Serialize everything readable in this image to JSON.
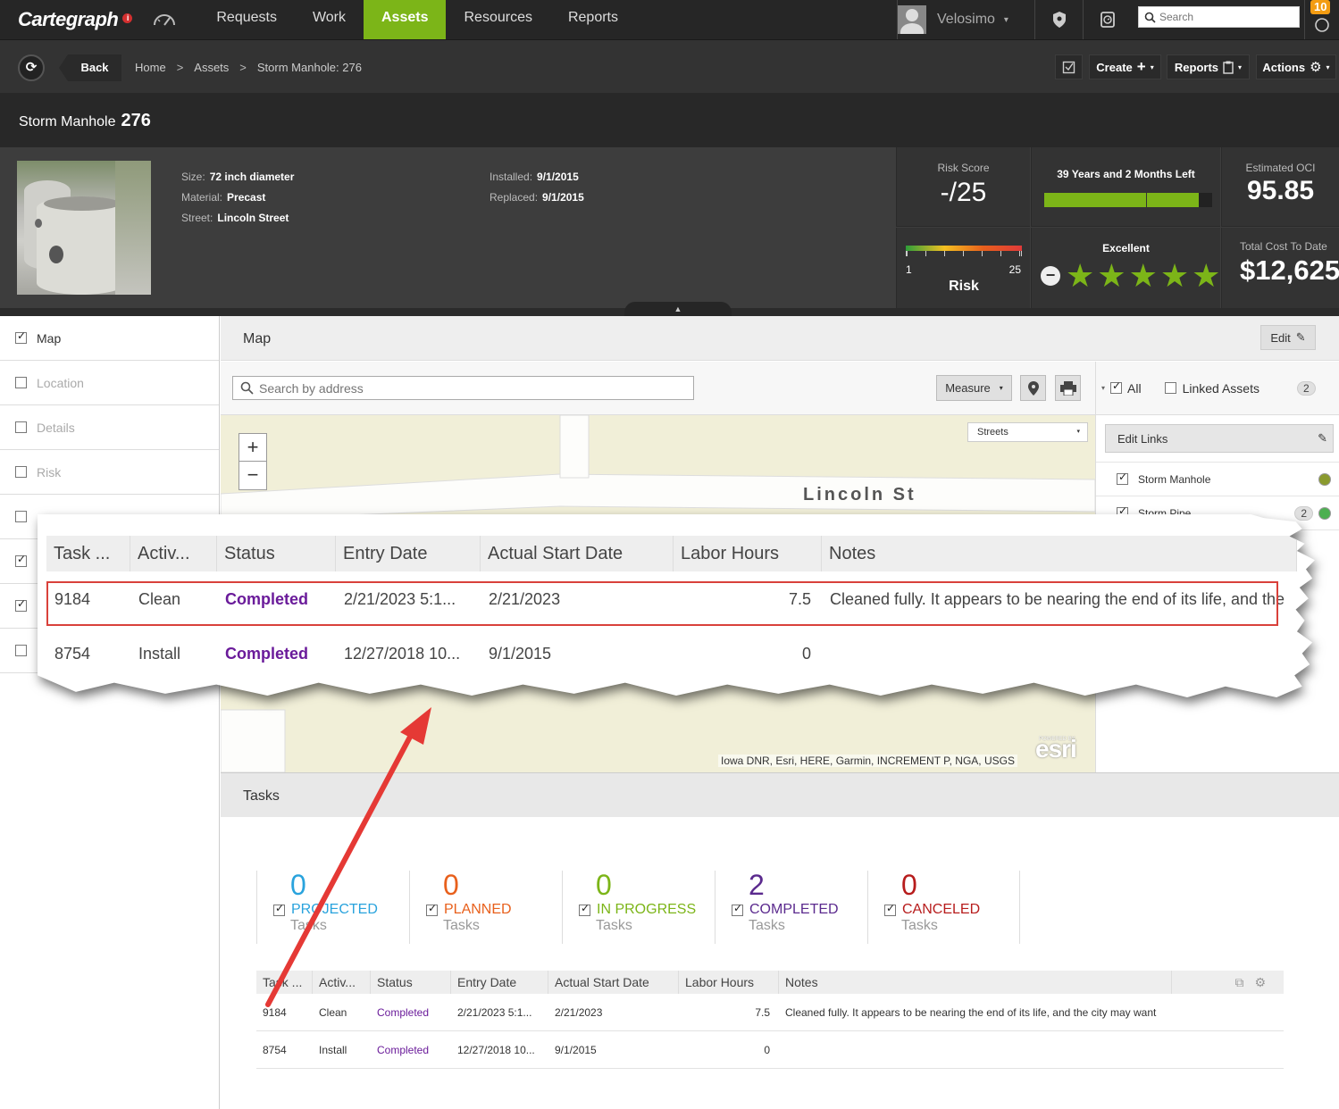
{
  "app": {
    "logo": "Cartegraph",
    "logo_badge": "i"
  },
  "nav": {
    "items": [
      "Requests",
      "Work",
      "Assets",
      "Resources",
      "Reports"
    ],
    "active": "Assets",
    "user": "Velosimo",
    "search_placeholder": "Search",
    "notification_count": "10"
  },
  "subhead": {
    "back": "Back",
    "breadcrumb": [
      "Home",
      "Assets",
      "Storm Manhole: 276"
    ],
    "create": "Create",
    "reports": "Reports",
    "actions": "Actions"
  },
  "record": {
    "type": "Storm Manhole",
    "id": "276"
  },
  "attributes": {
    "size_label": "Size:",
    "size": "72 inch diameter",
    "material_label": "Material:",
    "material": "Precast",
    "street_label": "Street:",
    "street": "Lincoln Street",
    "installed_label": "Installed:",
    "installed": "9/1/2015",
    "replaced_label": "Replaced:",
    "replaced": "9/1/2015"
  },
  "tiles": {
    "risk_score_label": "Risk Score",
    "risk_score": "-/25",
    "risk_min": "1",
    "risk_max": "25",
    "risk_label": "Risk",
    "life_left": "39 Years and 2 Months Left",
    "life_fraction": 0.92,
    "condition_label": "Excellent",
    "stars": 5,
    "oci_label": "Estimated OCI",
    "oci": "95.85",
    "cost_label": "Total Cost To Date",
    "cost": "$12,625"
  },
  "sections": [
    {
      "label": "Map",
      "checked": true
    },
    {
      "label": "Location",
      "checked": false
    },
    {
      "label": "Details",
      "checked": false
    },
    {
      "label": "Risk",
      "checked": false
    },
    {
      "label": "",
      "checked": false
    },
    {
      "label": "",
      "checked": true
    },
    {
      "label": "",
      "checked": true
    },
    {
      "label": "",
      "checked": false
    }
  ],
  "map": {
    "title": "Map",
    "edit": "Edit",
    "search_placeholder": "Search by address",
    "measure": "Measure",
    "basemap": "Streets",
    "street_label": "Lincoln St",
    "attribution": "Iowa DNR, Esri, HERE, Garmin, INCREMENT P, NGA, USGS",
    "esri": "esri",
    "esri_powered": "POWERED BY"
  },
  "links": {
    "all": "All",
    "linked_assets": "Linked Assets",
    "count": "2",
    "edit_links": "Edit Links",
    "items": [
      {
        "name": "Storm Manhole",
        "count": "",
        "color": "#8a9a2e"
      },
      {
        "name": "Storm Pipe",
        "count": "2",
        "color": "#4caf50"
      }
    ]
  },
  "tasks": {
    "title": "Tasks",
    "stats": [
      {
        "count": "0",
        "label": "PROJECTED",
        "sub": "Tasks",
        "color": "#29a3dd"
      },
      {
        "count": "0",
        "label": "PLANNED",
        "sub": "Tasks",
        "color": "#e8601c"
      },
      {
        "count": "0",
        "label": "IN PROGRESS",
        "sub": "Tasks",
        "color": "#7cb518"
      },
      {
        "count": "2",
        "label": "COMPLETED",
        "sub": "Tasks",
        "color": "#5b2a8e"
      },
      {
        "count": "0",
        "label": "CANCELED",
        "sub": "Tasks",
        "color": "#b71c1c"
      }
    ],
    "columns": [
      "Task ...",
      "Activ...",
      "Status",
      "Entry Date",
      "Actual Start Date",
      "Labor Hours",
      "Notes"
    ],
    "callout_columns": [
      "Task ...",
      "Activ...",
      "Status",
      "Entry Date",
      "Actual Start Date",
      "Labor Hours",
      "Notes"
    ],
    "rows": [
      {
        "task": "9184",
        "activity": "Clean",
        "status": "Completed",
        "entry": "2/21/2023 5:1...",
        "start": "2/21/2023",
        "hours": "7.5",
        "notes": "Cleaned fully. It appears to be nearing the end of its life, and the city may want",
        "callout_notes": "Cleaned fully. It appears to be nearing the end of its life, and the"
      },
      {
        "task": "8754",
        "activity": "Install",
        "status": "Completed",
        "entry": "12/27/2018 10...",
        "start": "9/1/2015",
        "hours": "0",
        "notes": "",
        "callout_notes": ""
      }
    ]
  }
}
